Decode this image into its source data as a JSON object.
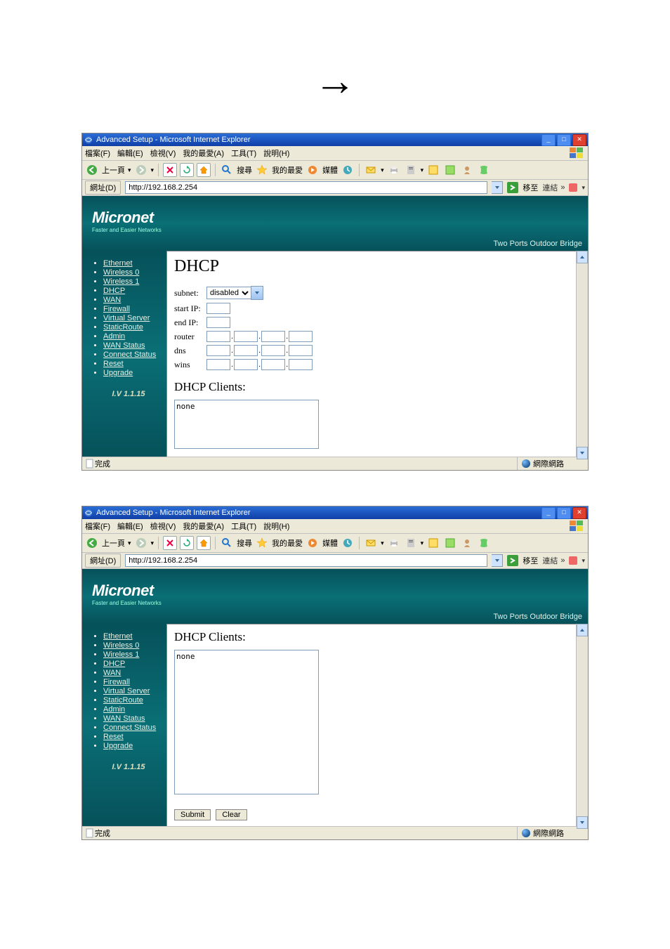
{
  "arrow": "→",
  "window": {
    "title": "Advanced Setup - Microsoft Internet Explorer",
    "menu": [
      "檔案(F)",
      "編輯(E)",
      "檢視(V)",
      "我的最愛(A)",
      "工具(T)",
      "說明(H)"
    ],
    "toolbar": {
      "back": "上一頁",
      "search": "搜尋",
      "favorites": "我的最愛",
      "media": "媒體"
    },
    "addressLabel": "網址(D)",
    "addressValue": "http://192.168.2.254",
    "go": "移至",
    "links": "連結",
    "statusDone": "完成",
    "statusZone": "網際網路"
  },
  "banner": {
    "brand": "Micronet",
    "sub": "Faster and Easier Networks",
    "slogan": "Two Ports Outdoor Bridge"
  },
  "nav": {
    "items": [
      "Ethernet",
      "Wireless 0",
      "Wireless 1",
      "DHCP",
      "WAN",
      "Firewall",
      "Virtual Server",
      "StaticRoute",
      "Admin",
      "WAN Status",
      "Connect Status",
      "Reset",
      "Upgrade"
    ],
    "version": "I.V 1.1.15"
  },
  "dhcp": {
    "heading": "DHCP",
    "labels": {
      "subnet": "subnet:",
      "startIP": "start IP:",
      "endIP": "end IP:",
      "router": "router",
      "dns": "dns",
      "wins": "wins"
    },
    "subnetValue": "disabled",
    "clientsHeading": "DHCP Clients:",
    "clientsValue": "none"
  },
  "buttons": {
    "submit": "Submit",
    "clear": "Clear"
  }
}
